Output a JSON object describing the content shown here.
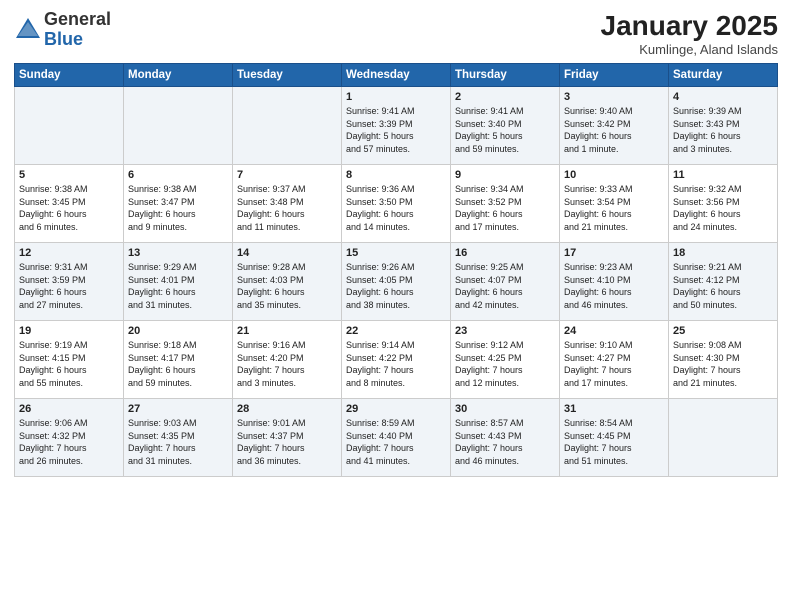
{
  "logo": {
    "general": "General",
    "blue": "Blue"
  },
  "title": {
    "month_year": "January 2025",
    "location": "Kumlinge, Aland Islands"
  },
  "days_of_week": [
    "Sunday",
    "Monday",
    "Tuesday",
    "Wednesday",
    "Thursday",
    "Friday",
    "Saturday"
  ],
  "weeks": [
    [
      {
        "day": "",
        "info": ""
      },
      {
        "day": "",
        "info": ""
      },
      {
        "day": "",
        "info": ""
      },
      {
        "day": "1",
        "info": "Sunrise: 9:41 AM\nSunset: 3:39 PM\nDaylight: 5 hours\nand 57 minutes."
      },
      {
        "day": "2",
        "info": "Sunrise: 9:41 AM\nSunset: 3:40 PM\nDaylight: 5 hours\nand 59 minutes."
      },
      {
        "day": "3",
        "info": "Sunrise: 9:40 AM\nSunset: 3:42 PM\nDaylight: 6 hours\nand 1 minute."
      },
      {
        "day": "4",
        "info": "Sunrise: 9:39 AM\nSunset: 3:43 PM\nDaylight: 6 hours\nand 3 minutes."
      }
    ],
    [
      {
        "day": "5",
        "info": "Sunrise: 9:38 AM\nSunset: 3:45 PM\nDaylight: 6 hours\nand 6 minutes."
      },
      {
        "day": "6",
        "info": "Sunrise: 9:38 AM\nSunset: 3:47 PM\nDaylight: 6 hours\nand 9 minutes."
      },
      {
        "day": "7",
        "info": "Sunrise: 9:37 AM\nSunset: 3:48 PM\nDaylight: 6 hours\nand 11 minutes."
      },
      {
        "day": "8",
        "info": "Sunrise: 9:36 AM\nSunset: 3:50 PM\nDaylight: 6 hours\nand 14 minutes."
      },
      {
        "day": "9",
        "info": "Sunrise: 9:34 AM\nSunset: 3:52 PM\nDaylight: 6 hours\nand 17 minutes."
      },
      {
        "day": "10",
        "info": "Sunrise: 9:33 AM\nSunset: 3:54 PM\nDaylight: 6 hours\nand 21 minutes."
      },
      {
        "day": "11",
        "info": "Sunrise: 9:32 AM\nSunset: 3:56 PM\nDaylight: 6 hours\nand 24 minutes."
      }
    ],
    [
      {
        "day": "12",
        "info": "Sunrise: 9:31 AM\nSunset: 3:59 PM\nDaylight: 6 hours\nand 27 minutes."
      },
      {
        "day": "13",
        "info": "Sunrise: 9:29 AM\nSunset: 4:01 PM\nDaylight: 6 hours\nand 31 minutes."
      },
      {
        "day": "14",
        "info": "Sunrise: 9:28 AM\nSunset: 4:03 PM\nDaylight: 6 hours\nand 35 minutes."
      },
      {
        "day": "15",
        "info": "Sunrise: 9:26 AM\nSunset: 4:05 PM\nDaylight: 6 hours\nand 38 minutes."
      },
      {
        "day": "16",
        "info": "Sunrise: 9:25 AM\nSunset: 4:07 PM\nDaylight: 6 hours\nand 42 minutes."
      },
      {
        "day": "17",
        "info": "Sunrise: 9:23 AM\nSunset: 4:10 PM\nDaylight: 6 hours\nand 46 minutes."
      },
      {
        "day": "18",
        "info": "Sunrise: 9:21 AM\nSunset: 4:12 PM\nDaylight: 6 hours\nand 50 minutes."
      }
    ],
    [
      {
        "day": "19",
        "info": "Sunrise: 9:19 AM\nSunset: 4:15 PM\nDaylight: 6 hours\nand 55 minutes."
      },
      {
        "day": "20",
        "info": "Sunrise: 9:18 AM\nSunset: 4:17 PM\nDaylight: 6 hours\nand 59 minutes."
      },
      {
        "day": "21",
        "info": "Sunrise: 9:16 AM\nSunset: 4:20 PM\nDaylight: 7 hours\nand 3 minutes."
      },
      {
        "day": "22",
        "info": "Sunrise: 9:14 AM\nSunset: 4:22 PM\nDaylight: 7 hours\nand 8 minutes."
      },
      {
        "day": "23",
        "info": "Sunrise: 9:12 AM\nSunset: 4:25 PM\nDaylight: 7 hours\nand 12 minutes."
      },
      {
        "day": "24",
        "info": "Sunrise: 9:10 AM\nSunset: 4:27 PM\nDaylight: 7 hours\nand 17 minutes."
      },
      {
        "day": "25",
        "info": "Sunrise: 9:08 AM\nSunset: 4:30 PM\nDaylight: 7 hours\nand 21 minutes."
      }
    ],
    [
      {
        "day": "26",
        "info": "Sunrise: 9:06 AM\nSunset: 4:32 PM\nDaylight: 7 hours\nand 26 minutes."
      },
      {
        "day": "27",
        "info": "Sunrise: 9:03 AM\nSunset: 4:35 PM\nDaylight: 7 hours\nand 31 minutes."
      },
      {
        "day": "28",
        "info": "Sunrise: 9:01 AM\nSunset: 4:37 PM\nDaylight: 7 hours\nand 36 minutes."
      },
      {
        "day": "29",
        "info": "Sunrise: 8:59 AM\nSunset: 4:40 PM\nDaylight: 7 hours\nand 41 minutes."
      },
      {
        "day": "30",
        "info": "Sunrise: 8:57 AM\nSunset: 4:43 PM\nDaylight: 7 hours\nand 46 minutes."
      },
      {
        "day": "31",
        "info": "Sunrise: 8:54 AM\nSunset: 4:45 PM\nDaylight: 7 hours\nand 51 minutes."
      },
      {
        "day": "",
        "info": ""
      }
    ]
  ]
}
